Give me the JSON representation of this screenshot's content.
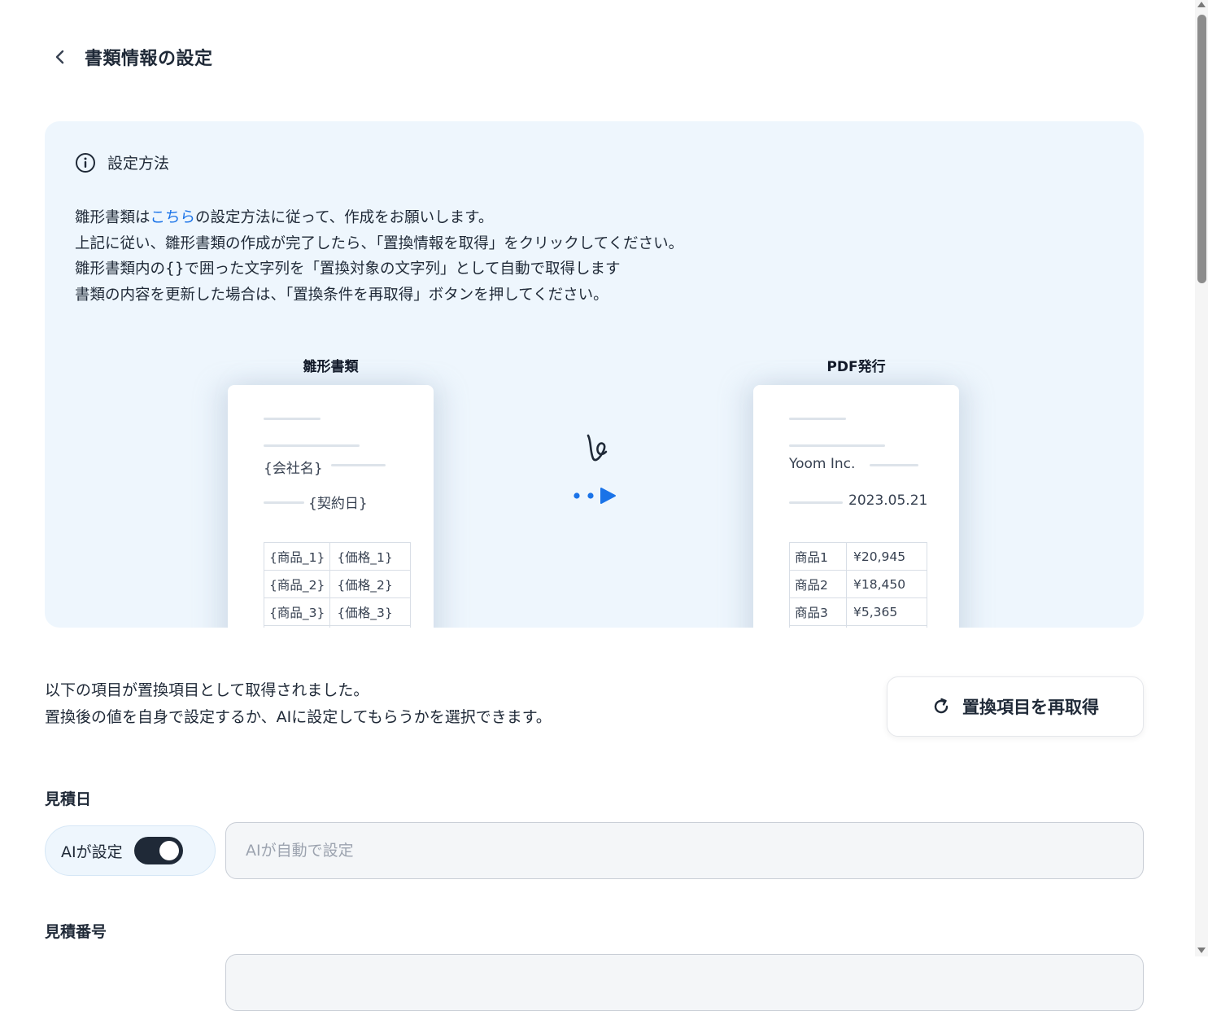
{
  "header": {
    "title": "書類情報の設定"
  },
  "info": {
    "title": "設定方法",
    "line1_pre": "雛形書類は",
    "line1_link": "こちら",
    "line1_post": "の設定方法に従って、作成をお願いします。",
    "line2": "上記に従い、雛形書類の作成が完了したら、「置換情報を取得」をクリックしてください。",
    "line3": "雛形書類内の{}で囲った文字列を「置換対象の文字列」として自動で取得します",
    "line4": "書類の内容を更新した場合は、「置換条件を再取得」ボタンを押してください。"
  },
  "illustration": {
    "template_label": "雛形書類",
    "template_company": "{会社名}",
    "template_date": "{契約日}",
    "template_rows": [
      [
        "{商品_1}",
        "{価格_1}"
      ],
      [
        "{商品_2}",
        "{価格_2}"
      ],
      [
        "{商品_3}",
        "{価格_3}"
      ]
    ],
    "pdf_label": "PDF発行",
    "pdf_company": "Yoom Inc.",
    "pdf_date": "2023.05.21",
    "pdf_rows": [
      [
        "商品1",
        "¥20,945"
      ],
      [
        "商品2",
        "¥18,450"
      ],
      [
        "商品3",
        "¥5,365"
      ]
    ]
  },
  "results": {
    "desc_line1": "以下の項目が置換項目として取得されました。",
    "desc_line2": "置換後の値を自身で設定するか、AIに設定してもらうかを選択できます。",
    "refetch_label": "置換項目を再取得"
  },
  "fields": [
    {
      "label": "見積日",
      "ai_label": "AIが設定",
      "ai_enabled": true,
      "placeholder": "AIが自動で設定"
    },
    {
      "label": "見積番号"
    }
  ],
  "colors": {
    "accent": "#1a73e8",
    "card_bg": "#eef6fd",
    "toggle_on": "#1f2937"
  }
}
